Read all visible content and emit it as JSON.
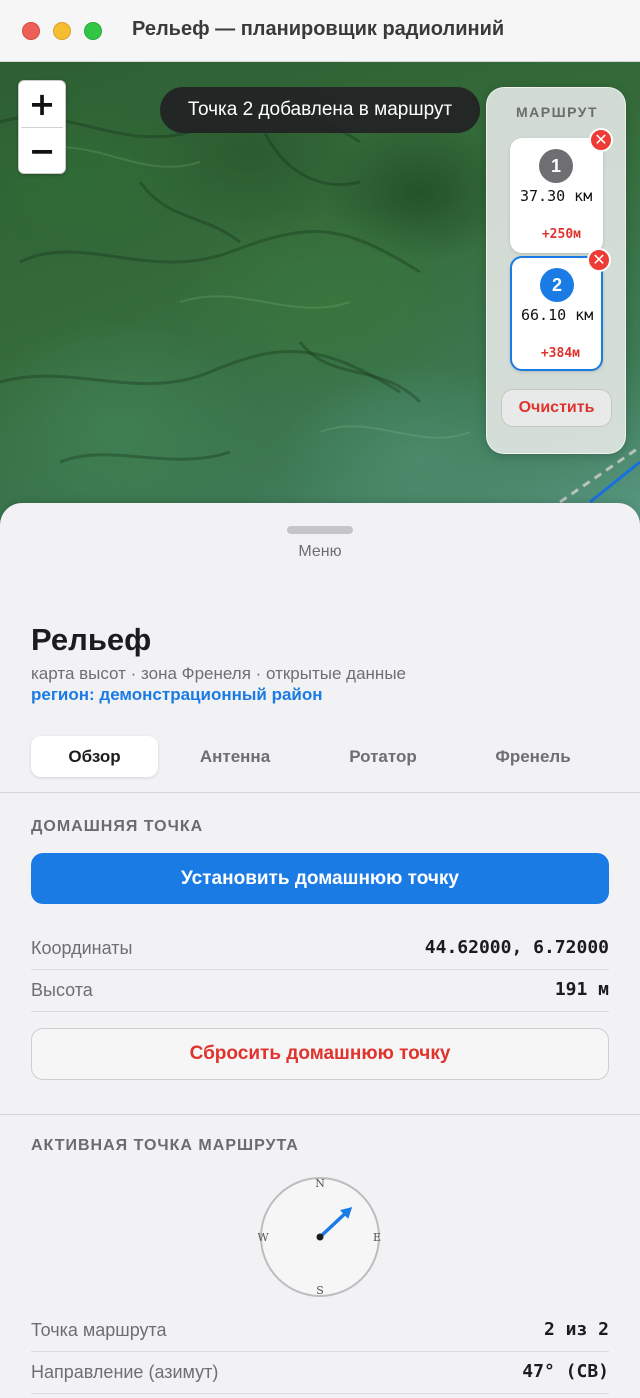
{
  "window": {
    "title": "Рельеф — планировщик радиолиний"
  },
  "map": {
    "zoom_in": "+",
    "zoom_out": "−",
    "toast": "Точка 2 добавлена в маршрут"
  },
  "route_panel": {
    "title": "МАРШРУТ",
    "points": [
      {
        "number": "1",
        "distance": "37.30 км",
        "gain": "+250м",
        "remove": "✕"
      },
      {
        "number": "2",
        "distance": "66.10 км",
        "gain": "+384м",
        "remove": "✕"
      }
    ],
    "clear_label": "Очистить"
  },
  "sheet": {
    "menu_label": "Меню",
    "app_name": "Рельеф",
    "subtitle": "карта высот · зона Френеля · открытые данные",
    "region": "регион: демонстрационный район",
    "tabs": [
      "Обзор",
      "Антенна",
      "Ротатор",
      "Френель"
    ],
    "home": {
      "section_title": "ДОМАШНЯЯ ТОЧКА",
      "set_button": "Установить домашнюю точку",
      "rows": [
        {
          "label": "Координаты",
          "value": "44.62000, 6.72000"
        },
        {
          "label": "Высота",
          "value": "191 м"
        }
      ],
      "reset_button": "Сбросить домашнюю точку"
    },
    "active_point": {
      "section_title": "АКТИВНАЯ ТОЧКА МАРШРУТА",
      "compass": {
        "n": "N",
        "e": "E",
        "s": "S",
        "w": "W",
        "azimuth_deg": 47,
        "arrow_color": "#1a7be5"
      },
      "rows": [
        {
          "label": "Точка маршрута",
          "value": "2 из 2"
        },
        {
          "label": "Направление (азимут)",
          "value": "47° (СВ)"
        }
      ]
    }
  },
  "colors": {
    "accent": "#1a7be5",
    "danger": "#e0332d"
  }
}
